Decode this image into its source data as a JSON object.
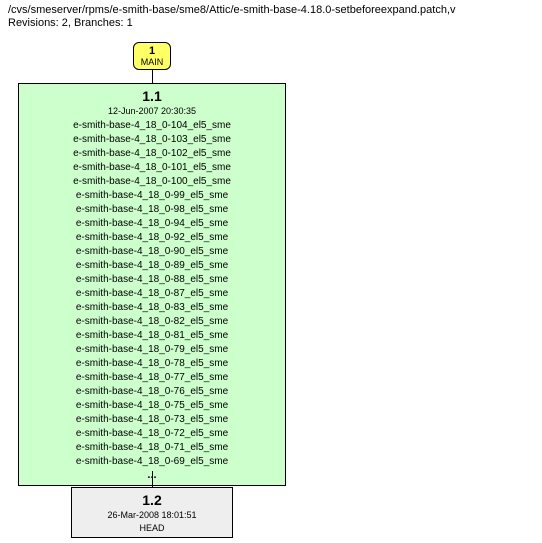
{
  "header": {
    "path": "/cvs/smeserver/rpms/e-smith-base/sme8/Attic/e-smith-base-4.18.0-setbeforeexpand.patch,v",
    "meta": "Revisions: 2, Branches: 1"
  },
  "branch": {
    "num": "1",
    "label": "MAIN"
  },
  "rev1": {
    "num": "1.1",
    "date": "12-Jun-2007 20:30:35",
    "tags": [
      "e-smith-base-4_18_0-104_el5_sme",
      "e-smith-base-4_18_0-103_el5_sme",
      "e-smith-base-4_18_0-102_el5_sme",
      "e-smith-base-4_18_0-101_el5_sme",
      "e-smith-base-4_18_0-100_el5_sme",
      "e-smith-base-4_18_0-99_el5_sme",
      "e-smith-base-4_18_0-98_el5_sme",
      "e-smith-base-4_18_0-94_el5_sme",
      "e-smith-base-4_18_0-92_el5_sme",
      "e-smith-base-4_18_0-90_el5_sme",
      "e-smith-base-4_18_0-89_el5_sme",
      "e-smith-base-4_18_0-88_el5_sme",
      "e-smith-base-4_18_0-87_el5_sme",
      "e-smith-base-4_18_0-83_el5_sme",
      "e-smith-base-4_18_0-82_el5_sme",
      "e-smith-base-4_18_0-81_el5_sme",
      "e-smith-base-4_18_0-79_el5_sme",
      "e-smith-base-4_18_0-78_el5_sme",
      "e-smith-base-4_18_0-77_el5_sme",
      "e-smith-base-4_18_0-76_el5_sme",
      "e-smith-base-4_18_0-75_el5_sme",
      "e-smith-base-4_18_0-73_el5_sme",
      "e-smith-base-4_18_0-72_el5_sme",
      "e-smith-base-4_18_0-71_el5_sme",
      "e-smith-base-4_18_0-69_el5_sme"
    ],
    "ellipsis": "..."
  },
  "rev2": {
    "num": "1.2",
    "date": "26-Mar-2008 18:01:51",
    "head": "HEAD"
  }
}
